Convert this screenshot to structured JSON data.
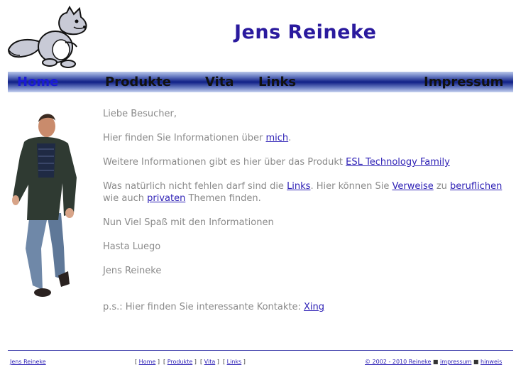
{
  "header": {
    "title": "Jens Reineke"
  },
  "nav": {
    "home": "Home",
    "produkte": "Produkte",
    "vita": "Vita",
    "links": "Links",
    "impressum": "Impressum"
  },
  "content": {
    "greeting": "Liebe Besucher,",
    "p1_pre": "Hier finden Sie Informationen über ",
    "p1_link": "mich",
    "p1_post": ".",
    "p2_pre": "Weitere Informationen gibt es hier über das Produkt ",
    "p2_link": "ESL Technology Family",
    "p3_pre": "Was natürlich nicht fehlen darf sind die ",
    "p3_link1": "Links",
    "p3_mid1": ". Hier können Sie ",
    "p3_link2": "Verweise",
    "p3_mid2": " zu ",
    "p3_link3": "beruflichen",
    "p3_mid3": " wie auch ",
    "p3_link4": "privaten",
    "p3_post": " Themen finden.",
    "p4": "Nun Viel Spaß mit den Informationen",
    "p5": "Hasta Luego",
    "p6": "Jens Reineke",
    "ps_pre": "p.s.: Hier finden Sie interessante Kontakte: ",
    "ps_link": "Xing"
  },
  "footer": {
    "author": "Jens Reineke",
    "home": "Home",
    "produkte": "Produkte",
    "vita": "Vita",
    "links": "Links",
    "copyright": "© 2002 - 2010 Reineke",
    "impressum": "impressum",
    "hinweis": "hinweis"
  },
  "colors": {
    "title": "#2a1a9e",
    "nav_dark": "#0f1f86",
    "link": "#2c1fb5",
    "text": "#8a8a8a"
  }
}
